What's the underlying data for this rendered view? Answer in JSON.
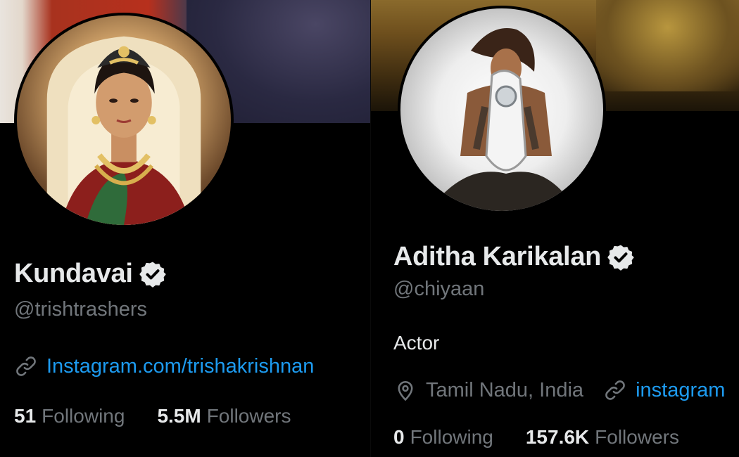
{
  "left_profile": {
    "display_name": "Kundavai",
    "verified_icon": "verified-badge-icon",
    "handle": "@trishtrashers",
    "link": "Instagram.com/trishakrishnan",
    "link_icon": "link-icon",
    "following_count": "51",
    "following_label": "Following",
    "followers_count": "5.5M",
    "followers_label": "Followers"
  },
  "right_profile": {
    "display_name": "Aditha Karikalan",
    "verified_icon": "verified-badge-icon",
    "handle": "@chiyaan",
    "bio": "Actor",
    "location": "Tamil Nadu, India",
    "location_icon": "location-pin-icon",
    "link": "instagram",
    "link_icon": "link-icon",
    "following_count": "0",
    "following_label": "Following",
    "followers_count": "157.6K",
    "followers_label": "Followers"
  },
  "colors": {
    "background": "#000000",
    "primary_text": "#e7e9ea",
    "secondary_text": "#71767b",
    "link": "#1d9bf0",
    "verified_badge": "#e7e9ea"
  }
}
